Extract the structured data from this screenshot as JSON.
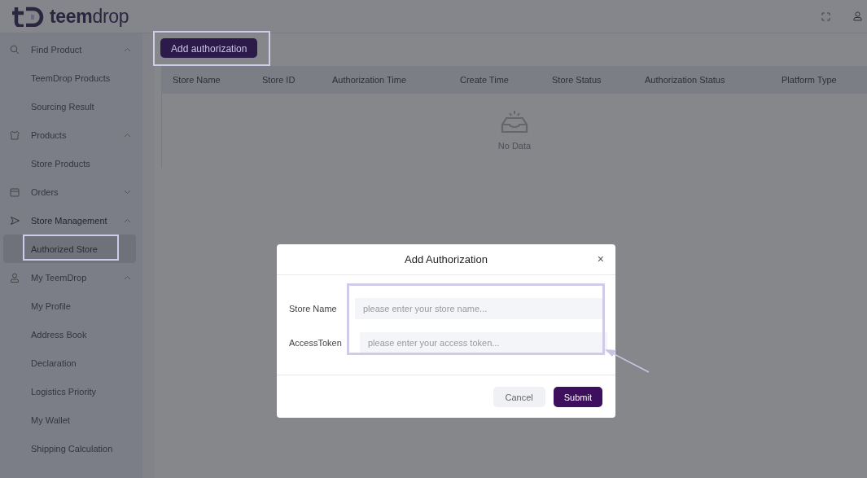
{
  "header": {
    "logo": "**teem**drop"
  },
  "sidebar": {
    "groups": [
      {
        "label": "Find Product",
        "expanded": true,
        "children": [
          {
            "label": "TeemDrop Products",
            "selected": false,
            "highlighted": false
          },
          {
            "label": "Sourcing Result",
            "selected": false,
            "highlighted": false
          }
        ]
      },
      {
        "label": "Products",
        "expanded": true,
        "children": [
          {
            "label": "Store Products",
            "selected": false,
            "highlighted": false
          }
        ]
      },
      {
        "label": "Orders",
        "expanded": false
      },
      {
        "label": "Store Management",
        "expanded": true,
        "children": [
          {
            "label": "Authorized Store",
            "selected": true,
            "highlighted": true
          }
        ]
      },
      {
        "label": "My TeemDrop",
        "expanded": true,
        "children": [
          {
            "label": "My Profile",
            "selected": false,
            "highlighted": false
          },
          {
            "label": "Address Book",
            "selected": false,
            "highlighted": false
          },
          {
            "label": "Declaration",
            "selected": false,
            "highlighted": false
          },
          {
            "label": "Logistics Priority",
            "selected": false,
            "highlighted": false
          },
          {
            "label": "My Wallet",
            "selected": false,
            "highlighted": false
          },
          {
            "label": "Shipping Calculation",
            "selected": false,
            "highlighted": false
          }
        ]
      }
    ]
  },
  "toolbar": {
    "add_button": {
      "label": "Add authorization",
      "highlighted": true
    }
  },
  "table": {
    "columns": [
      "Store Name",
      "Store ID",
      "Authorization Time",
      "Create Time",
      "Store Status",
      "Authorization Status",
      "Platform Type"
    ],
    "empty_text": "No Data"
  },
  "dialog": {
    "title": "Add Authorization",
    "close": "×",
    "highlighted": true,
    "fields": [
      {
        "label": "Store Name",
        "placeholder": "please enter your store name..."
      },
      {
        "label": "AccessToken",
        "placeholder": "please enter your access token..."
      }
    ],
    "buttons": [
      {
        "label": "Cancel",
        "kind": "secondary"
      },
      {
        "label": "Submit",
        "kind": "primary"
      }
    ]
  }
}
